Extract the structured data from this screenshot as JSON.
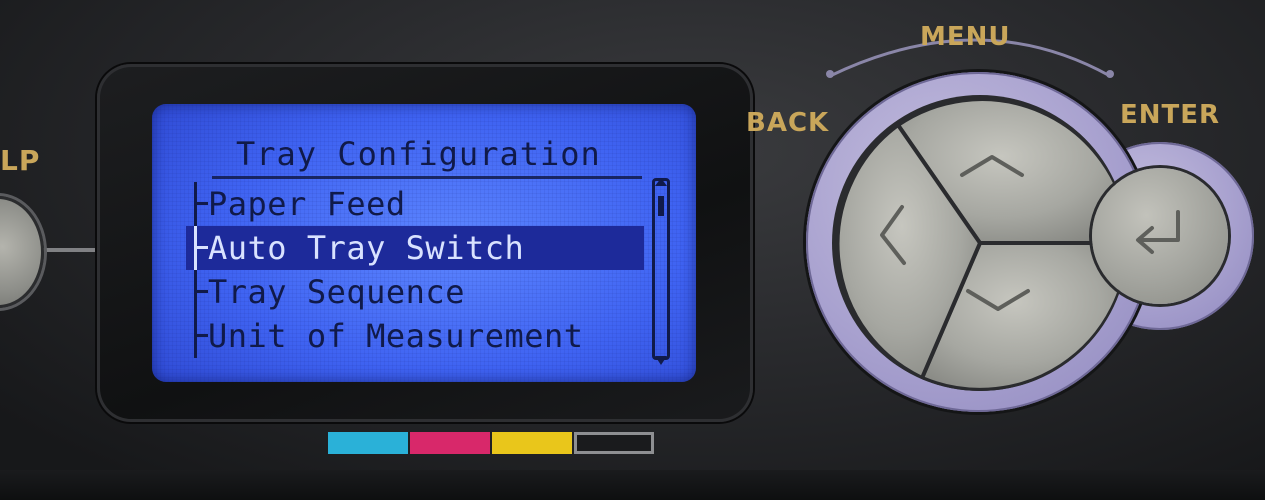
{
  "device": {
    "help_label": "LP"
  },
  "lcd": {
    "title": "Tray Configuration",
    "items": [
      {
        "label": "Paper Feed",
        "selected": false
      },
      {
        "label": "Auto Tray Switch",
        "selected": true
      },
      {
        "label": "Tray Sequence",
        "selected": false
      },
      {
        "label": "Unit of Measurement",
        "selected": false
      }
    ],
    "scroll_position": 0.05
  },
  "toner_indicators": [
    {
      "name": "cyan",
      "color": "#2ab1d8"
    },
    {
      "name": "magenta",
      "color": "#d8286a"
    },
    {
      "name": "yellow",
      "color": "#e9c61b"
    },
    {
      "name": "black",
      "color": "#1a1b1d"
    }
  ],
  "controls": {
    "menu_label": "MENU",
    "back_label": "BACK",
    "enter_label": "ENTER",
    "icons": {
      "up": "chevron-up-icon",
      "down": "chevron-down-icon",
      "left": "chevron-left-icon",
      "enter": "return-arrow-icon"
    }
  },
  "colors": {
    "lcd_background": "#4a6ff8",
    "lcd_text": "#101a4a",
    "lcd_highlight": "#1d2a9a",
    "label_gold": "#c9a65a",
    "ring_lavender": "#a8a1cf",
    "button_gray": "#a3a49e"
  }
}
